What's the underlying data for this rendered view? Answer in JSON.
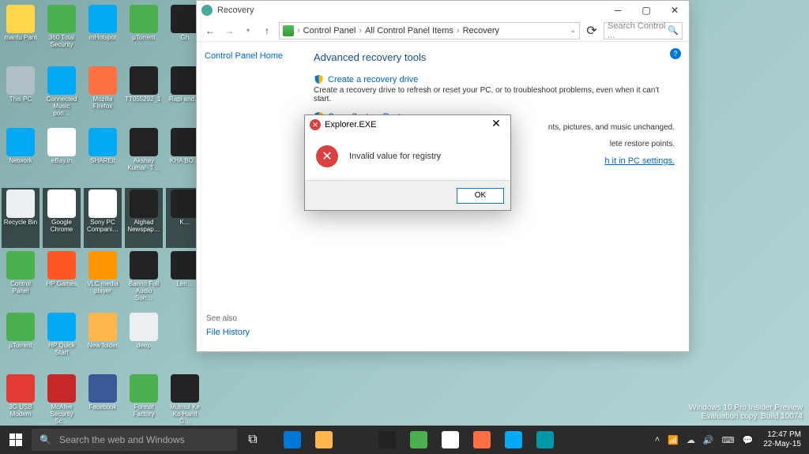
{
  "desktop_icons": [
    {
      "name": "user-icon",
      "label": "mantu Pant",
      "bg": "#ffd54a"
    },
    {
      "name": "security-360-icon",
      "label": "360 Total Security",
      "bg": "#4caf50"
    },
    {
      "name": "wifi-icon",
      "label": "mHotspot",
      "bg": "#03a9f4"
    },
    {
      "name": "utorrent-icon",
      "label": "µTorrent",
      "bg": "#4caf50"
    },
    {
      "name": "blank-icon",
      "label": "Gh",
      "bg": "#222"
    },
    {
      "name": "this-pc-icon",
      "label": "This PC",
      "bg": "#b0bec5"
    },
    {
      "name": "music-icon",
      "label": "Connected Music pon…",
      "bg": "#03a9f4"
    },
    {
      "name": "firefox-icon",
      "label": "Mozilla Firefox",
      "bg": "#ff7043"
    },
    {
      "name": "video1-icon",
      "label": "TT055292_1…",
      "bg": "#222"
    },
    {
      "name": "video2-icon",
      "label": "Rapi and…",
      "bg": "#222"
    },
    {
      "name": "network-icon",
      "label": "Network",
      "bg": "#03a9f4"
    },
    {
      "name": "ebay-icon",
      "label": "eBay.in",
      "bg": "#fff"
    },
    {
      "name": "shareit-icon",
      "label": "SHAREit",
      "bg": "#03a9f4"
    },
    {
      "name": "video3-icon",
      "label": "Akshay Kumar- T…",
      "bg": "#222"
    },
    {
      "name": "video4-icon",
      "label": "KHA BO…",
      "bg": "#222"
    },
    {
      "name": "recycle-bin-icon",
      "label": "Recycle Bin",
      "bg": "#eceff1",
      "sel": true
    },
    {
      "name": "chrome-icon",
      "label": "Google Chrome",
      "bg": "#fff",
      "sel": true
    },
    {
      "name": "sony-pc-icon",
      "label": "Sony PC Compani…",
      "bg": "#fff",
      "sel": true
    },
    {
      "name": "video5-icon",
      "label": "Alghad Newspap…",
      "bg": "#222",
      "sel": true
    },
    {
      "name": "video6-icon",
      "label": "K…",
      "bg": "#222",
      "sel": true
    },
    {
      "name": "control-panel-icon",
      "label": "Control Panel",
      "bg": "#4caf50"
    },
    {
      "name": "hp-games-icon",
      "label": "HP Games",
      "bg": "#ff5722"
    },
    {
      "name": "vlc-icon",
      "label": "VLC media player",
      "bg": "#ff9800"
    },
    {
      "name": "video7-icon",
      "label": "Banno Full Audio Son…",
      "bg": "#222"
    },
    {
      "name": "lenovo-icon",
      "label": "Len…",
      "bg": "#222"
    },
    {
      "name": "utorrent2-icon",
      "label": "µTorrent",
      "bg": "#4caf50"
    },
    {
      "name": "hp-quick-icon",
      "label": "HP Quick Start",
      "bg": "#03a9f4"
    },
    {
      "name": "folder-icon",
      "label": "New folder",
      "bg": "#ffb74d"
    },
    {
      "name": "wordpad-icon",
      "label": "deep",
      "bg": "#eceff1"
    },
    {
      "name": "blank2-icon",
      "label": "",
      "bg": "transparent"
    },
    {
      "name": "lava-icon",
      "label": "3G USB Modem",
      "bg": "#e53935"
    },
    {
      "name": "mcafee-icon",
      "label": "McAfee Security Sc…",
      "bg": "#c62828"
    },
    {
      "name": "facebook-icon",
      "label": "Facebook",
      "bg": "#3b5998"
    },
    {
      "name": "format-factory-icon",
      "label": "Format Factory",
      "bg": "#4caf50"
    },
    {
      "name": "video8-icon",
      "label": "Mulmul Ke Ko Haml G…",
      "bg": "#222"
    }
  ],
  "recovery_window": {
    "title": "Recovery",
    "breadcrumb": [
      "Control Panel",
      "All Control Panel Items",
      "Recovery"
    ],
    "search_placeholder": "Search Control ...",
    "left": {
      "home": "Control Panel Home",
      "see_also": "See also",
      "file_history": "File History"
    },
    "main": {
      "heading": "Advanced recovery tools",
      "create_drive_link": "Create a recovery drive",
      "create_drive_desc": "Create a recovery drive to refresh or reset your PC, or to troubleshoot problems, even when it can't start.",
      "system_restore_link": "Open System Restore",
      "system_restore_frag": "nts, pictures, and music unchanged.",
      "configure_frag": "lete restore points.",
      "pc_settings_frag": "h it in PC settings."
    }
  },
  "dialog": {
    "title": "Explorer.EXE",
    "message": "Invalid value for registry",
    "ok": "OK"
  },
  "taskbar": {
    "search_placeholder": "Search the web and Windows",
    "apps": [
      {
        "name": "edge-icon",
        "bg": "#0078d7"
      },
      {
        "name": "file-explorer-icon",
        "bg": "#ffb74d"
      },
      {
        "name": "blank-task-icon",
        "bg": "transparent"
      },
      {
        "name": "spotify-icon",
        "bg": "#222"
      },
      {
        "name": "control-panel-task-icon",
        "bg": "#4caf50"
      },
      {
        "name": "chrome-task-icon",
        "bg": "#fff"
      },
      {
        "name": "firefox-task-icon",
        "bg": "#ff7043"
      },
      {
        "name": "music-task-icon",
        "bg": "#03a9f4"
      },
      {
        "name": "app-task-icon",
        "bg": "#0097a7"
      }
    ],
    "time": "12:47 PM",
    "date": "22-May-15"
  },
  "watermark": {
    "line1": "Windows 10 Pro Insider Preview",
    "line2": "Evaluation copy. Build 10074"
  }
}
